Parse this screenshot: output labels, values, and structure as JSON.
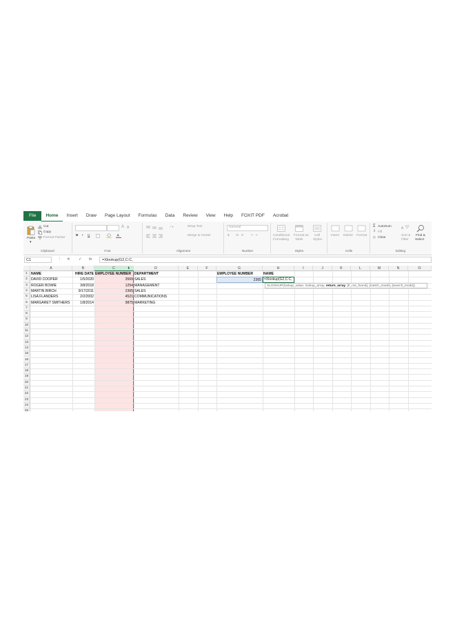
{
  "ribbon_tabs": [
    {
      "label": "File"
    },
    {
      "label": "Home"
    },
    {
      "label": "Insert"
    },
    {
      "label": "Draw"
    },
    {
      "label": "Page Layout"
    },
    {
      "label": "Formulas"
    },
    {
      "label": "Data"
    },
    {
      "label": "Review"
    },
    {
      "label": "View"
    },
    {
      "label": "Help"
    },
    {
      "label": "FOXIT PDF"
    },
    {
      "label": "Acrobat"
    }
  ],
  "clipboard": {
    "paste": "Paste",
    "cut": "Cut",
    "copy": "Copy",
    "format_painter": "Format Painter",
    "label": "Clipboard"
  },
  "font": {
    "label": "Font",
    "bold": "B",
    "italic": "I",
    "underline": "U",
    "grow": "A",
    "shrink": "A"
  },
  "alignment": {
    "wrap_text": "Wrap Text",
    "merge_center": "Merge & Center",
    "label": "Alignment"
  },
  "number": {
    "format": "General",
    "currency": "$",
    "percent": "%",
    "comma": "9",
    "label": "Number"
  },
  "styles": {
    "conditional": "Conditional",
    "formatting": "Formatting",
    "format_as": "Format as",
    "table": "Table",
    "cell": "Cell",
    "cell_styles": "Styles",
    "label": "Styles"
  },
  "cells": {
    "insert": "Insert",
    "delete": "Delete",
    "format": "Format",
    "label": "Cells"
  },
  "editing": {
    "autosum": "AutoSum",
    "fill": "Fill",
    "clear": "Clear",
    "sort": "Sort &",
    "filter": "Filter",
    "find": "Find &",
    "select": "Select",
    "label": "Editing"
  },
  "formula_bar": {
    "name_box": "C1",
    "cancel": "✕",
    "enter": "✓",
    "fx": "fx",
    "formula": "=Xlookup(G2,C:C,"
  },
  "columns": [
    "A",
    "B",
    "C",
    "D",
    "E",
    "F",
    "G",
    "H",
    "I",
    "J",
    "K",
    "L",
    "M",
    "N",
    "O"
  ],
  "rows": [
    "1",
    "2",
    "3",
    "4",
    "5",
    "6",
    "7",
    "8",
    "9",
    "10",
    "11",
    "12",
    "13",
    "14",
    "15",
    "16",
    "17",
    "18",
    "19",
    "20",
    "21",
    "22",
    "23",
    "24",
    "25"
  ],
  "table": {
    "headers": {
      "name": "NAME",
      "hire_date": "HIRE DATE",
      "employee_number": "EMPLOYEE NUMBER",
      "department": "DEPARTMENT"
    },
    "rows": [
      {
        "name": "DAVID COOPER",
        "hire_date": "1/5/2020",
        "employee_number": "3569",
        "department": "SALES"
      },
      {
        "name": "ROGER BOWIE",
        "hire_date": "3/8/2018",
        "employee_number": "1254",
        "department": "MANAGEMENT"
      },
      {
        "name": "MARTIN BIRCH",
        "hire_date": "9/17/2011",
        "employee_number": "2365",
        "department": "SALES"
      },
      {
        "name": "LISA FLANDERS",
        "hire_date": "2/2/2002",
        "employee_number": "4521",
        "department": "COMMUNICATIONS"
      },
      {
        "name": "MARGARET SMITHERS",
        "hire_date": "1/8/2014",
        "employee_number": "9875",
        "department": "MARKETING"
      }
    ]
  },
  "lookup": {
    "header_g": "EMPLOYEE NUMBER",
    "header_h": "NAME",
    "value_g2": "2365",
    "active_text": "=Xlookup(G2,C:C,",
    "tooltip_pre": "XLOOKUP(lookup_value, lookup_array, ",
    "tooltip_bold": "return_array",
    "tooltip_post": ", [if_not_found], [match_mode], [search_mode])"
  }
}
